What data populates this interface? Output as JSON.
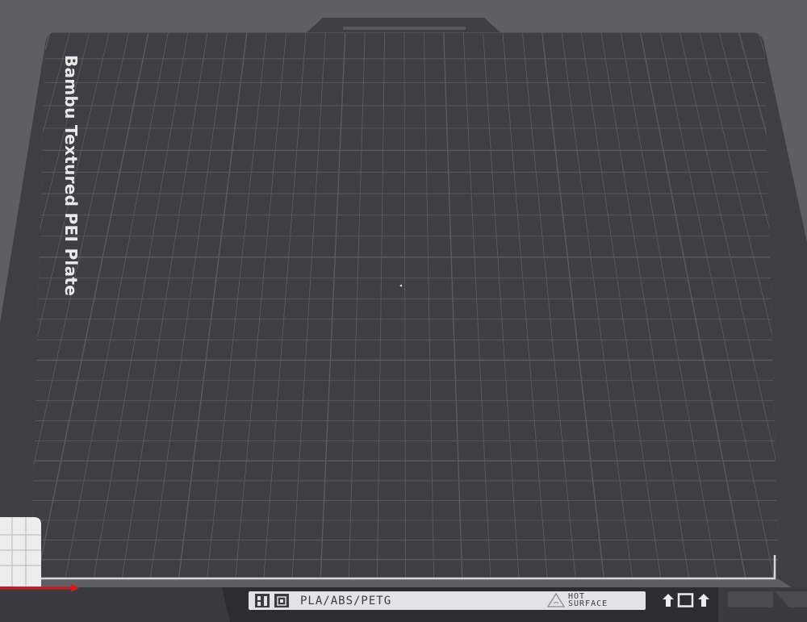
{
  "plate": {
    "name": "Bambu Textured PEI Plate",
    "materials": "PLA/ABS/PETG",
    "warning_line1": "HOT",
    "warning_line2": "SURFACE"
  },
  "colors": {
    "background": "#5e5e63",
    "plate": "#3e3e44",
    "grid": "#5a5a60",
    "plate_text": "#e9e9ea",
    "x_axis": "#d21a1a"
  },
  "icons": {
    "logo_1": "bambu-logo-icon",
    "logo_2": "plate-logo-icon",
    "warning": "warning-triangle-icon",
    "plate_type": "plate-type-icons"
  }
}
